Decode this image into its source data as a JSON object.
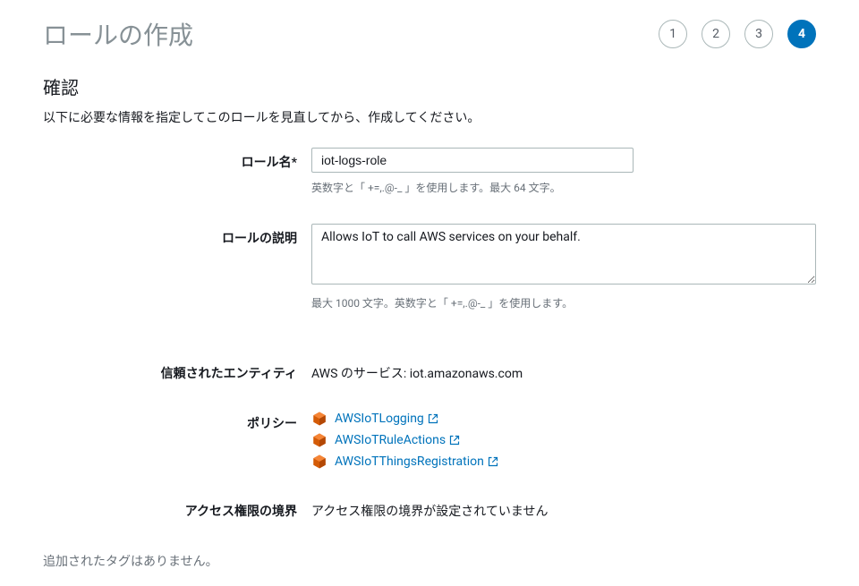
{
  "header": {
    "title": "ロールの作成",
    "steps": [
      "1",
      "2",
      "3",
      "4"
    ],
    "active_step": 3
  },
  "section": {
    "title": "確認",
    "description": "以下に必要な情報を指定してこのロールを見直してから、作成してください。"
  },
  "form": {
    "role_name": {
      "label": "ロール名*",
      "value": "iot-logs-role",
      "hint": "英数字と「 +=,.@-_ 」を使用します。最大 64 文字。"
    },
    "role_description": {
      "label": "ロールの説明",
      "value": "Allows IoT to call AWS services on your behalf.",
      "hint": "最大 1000 文字。英数字と「 +=,.@-_ 」を使用します。"
    },
    "trusted_entities": {
      "label": "信頼されたエンティティ",
      "value": "AWS のサービス: iot.amazonaws.com"
    },
    "policies": {
      "label": "ポリシー",
      "items": [
        {
          "name": "AWSIoTLogging"
        },
        {
          "name": "AWSIoTRuleActions"
        },
        {
          "name": "AWSIoTThingsRegistration"
        }
      ]
    },
    "permissions_boundary": {
      "label": "アクセス権限の境界",
      "value": "アクセス権限の境界が設定されていません"
    }
  },
  "footer": {
    "no_tags": "追加されたタグはありません。"
  }
}
